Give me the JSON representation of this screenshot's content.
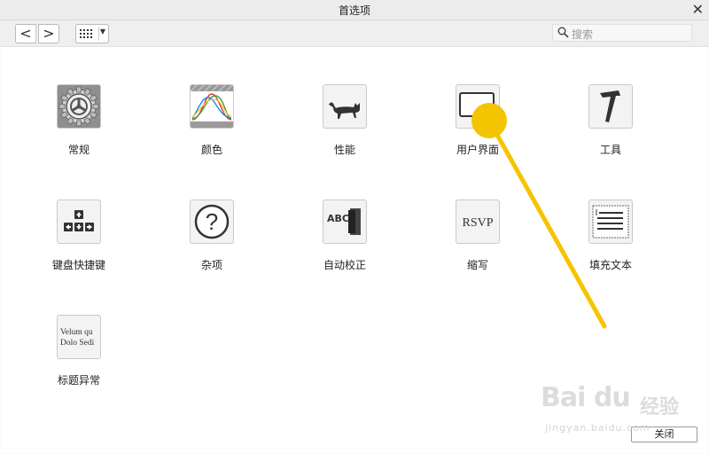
{
  "window": {
    "title": "首选项",
    "close_glyph": "✕"
  },
  "toolbar": {
    "back_glyph": "<",
    "forward_glyph": ">",
    "view_icon": "grid-icon",
    "search_placeholder": "搜索"
  },
  "preferences": [
    {
      "label": "常规",
      "icon": "gear-icon"
    },
    {
      "label": "颜色",
      "icon": "color-curves-icon"
    },
    {
      "label": "性能",
      "icon": "cat-icon"
    },
    {
      "label": "用户界面",
      "icon": "monitor-icon"
    },
    {
      "label": "工具",
      "icon": "hammer-icon"
    },
    {
      "label": "键盘快捷键",
      "icon": "keyboard-arrows-icon"
    },
    {
      "label": "杂项",
      "icon": "question-icon"
    },
    {
      "label": "自动校正",
      "icon": "abc-book-icon",
      "icon_text": "ABC"
    },
    {
      "label": "缩写",
      "icon": "rsvp-icon",
      "icon_text": "RSVP"
    },
    {
      "label": "填充文本",
      "icon": "text-block-icon"
    },
    {
      "label": "标题异常",
      "icon": "title-text-icon",
      "icon_text_1": "Velum qu",
      "icon_text_2": "Dolo Sedi"
    }
  ],
  "footer": {
    "close_label": "关闭"
  },
  "watermark": {
    "logo": "Bai du",
    "brand": "经验",
    "url": "jingyan.baidu.com"
  },
  "colors": {
    "highlight_pointer": "#f5c400"
  }
}
